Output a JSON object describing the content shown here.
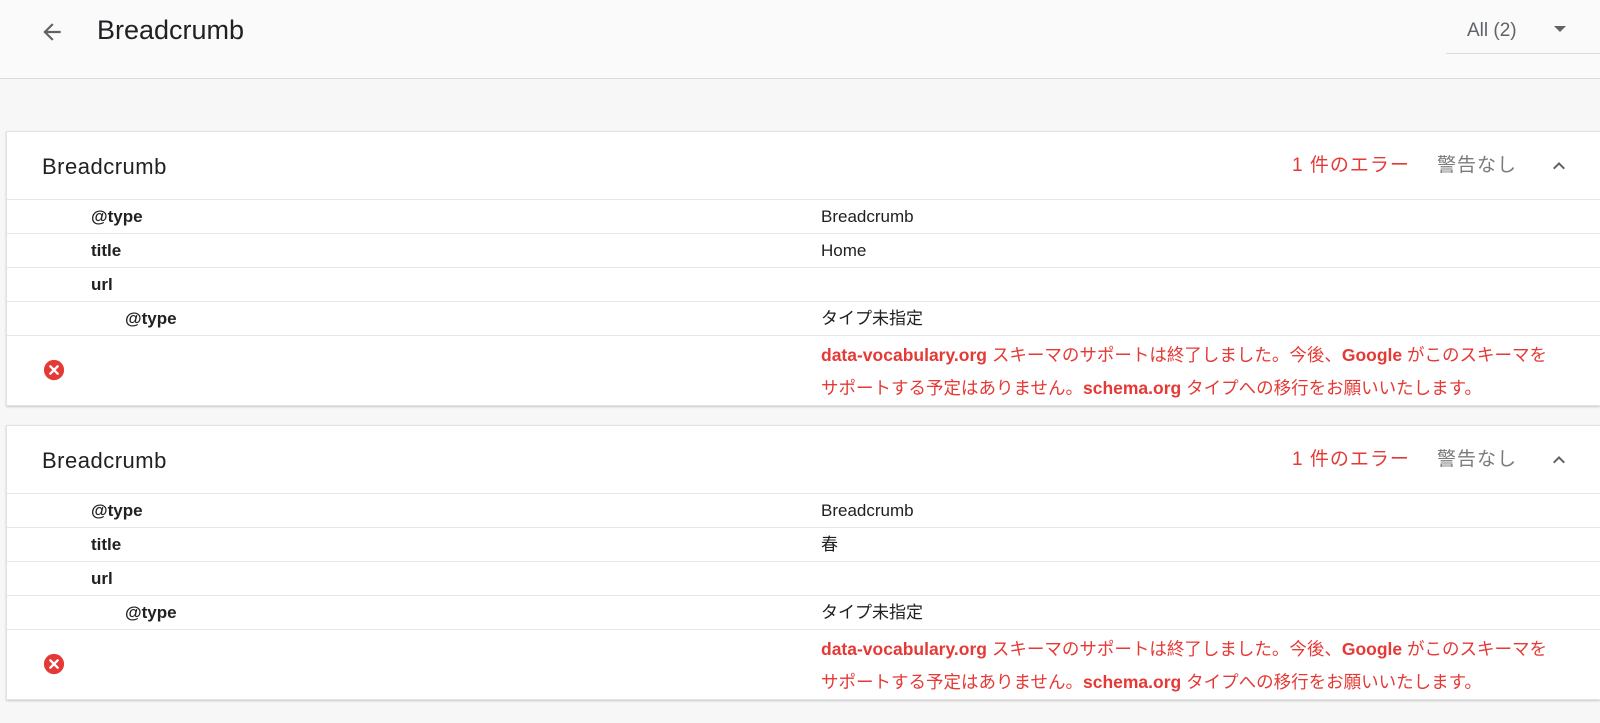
{
  "header": {
    "title": "Breadcrumb",
    "back_icon": "arrow-back-icon",
    "filter_label": "All (2)",
    "filter_icon": "caret-down-icon"
  },
  "colors": {
    "error": "#e53935",
    "muted": "#7b7b7b",
    "background": "#f7f7f7"
  },
  "cards": [
    {
      "title": "Breadcrumb",
      "error_count": "1 件のエラー",
      "warning_count": "警告なし",
      "collapse_icon": "chevron-up-icon",
      "rows": [
        {
          "key": "@type",
          "value": "Breadcrumb"
        },
        {
          "key": "title",
          "value": "Home"
        },
        {
          "key": "url",
          "value": ""
        },
        {
          "key": "@type",
          "value": "タイプ未指定"
        }
      ],
      "error": {
        "icon": "error-circle-icon",
        "part1_bold": "data-vocabulary.org",
        "part2": " スキーマのサポートは終了しました。今後、",
        "part3_bold": "Google",
        "part4": " がこのスキーマをサポートする予定はありません。",
        "part5_bold": "schema.org",
        "part6": " タイプへの移行をお願いいたします。"
      }
    },
    {
      "title": "Breadcrumb",
      "error_count": "1 件のエラー",
      "warning_count": "警告なし",
      "collapse_icon": "chevron-up-icon",
      "rows": [
        {
          "key": "@type",
          "value": "Breadcrumb"
        },
        {
          "key": "title",
          "value": "春"
        },
        {
          "key": "url",
          "value": ""
        },
        {
          "key": "@type",
          "value": "タイプ未指定"
        }
      ],
      "error": {
        "icon": "error-circle-icon",
        "part1_bold": "data-vocabulary.org",
        "part2": " スキーマのサポートは終了しました。今後、",
        "part3_bold": "Google",
        "part4": " がこのスキーマをサポートする予定はありません。",
        "part5_bold": "schema.org",
        "part6": " タイプへの移行をお願いいたします。"
      }
    }
  ]
}
